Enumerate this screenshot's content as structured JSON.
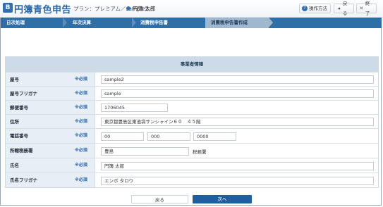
{
  "header": {
    "logo_icon_text": "B",
    "app_title": "円簿青色申告",
    "plan_text": "プラン：プレミアム／sample2／",
    "user_name": "円簿 太郎",
    "help_label": "操作方法",
    "back_label": "戻る",
    "exit_label": "終了"
  },
  "steps": [
    {
      "label": "日次処理"
    },
    {
      "label": "年次決算"
    },
    {
      "label": "消費税申告書"
    },
    {
      "label": "消費税申告書作成",
      "active": true
    }
  ],
  "panel": {
    "title": "事業者情報",
    "required_label": "※必須",
    "rows": [
      {
        "label": "屋号",
        "value": "sample2"
      },
      {
        "label": "屋号フリガナ",
        "value": "sample"
      },
      {
        "label": "郵便番号",
        "value": "1706045"
      },
      {
        "label": "住所",
        "value": "東京都豊島区東池袋サンシャイン６０　４５階"
      },
      {
        "label": "電話番号",
        "values": [
          "00",
          "000",
          "0000"
        ]
      },
      {
        "label": "所轄税務署",
        "value": "豊島",
        "suffix": "税務署"
      },
      {
        "label": "氏名",
        "value": "円簿 太郎"
      },
      {
        "label": "氏名フリガナ",
        "value": "エンボ タロウ"
      }
    ]
  },
  "footer": {
    "back_label": "戻る",
    "next_label": "次へ"
  },
  "colors": {
    "brand_blue": "#2b67a8",
    "step_bar": "#2e6fa7",
    "step_active": "#9fb8cf",
    "label_bg": "#e8eef5",
    "panel_title_bg": "#cddbe8",
    "next_button": "#1f5f9f"
  }
}
